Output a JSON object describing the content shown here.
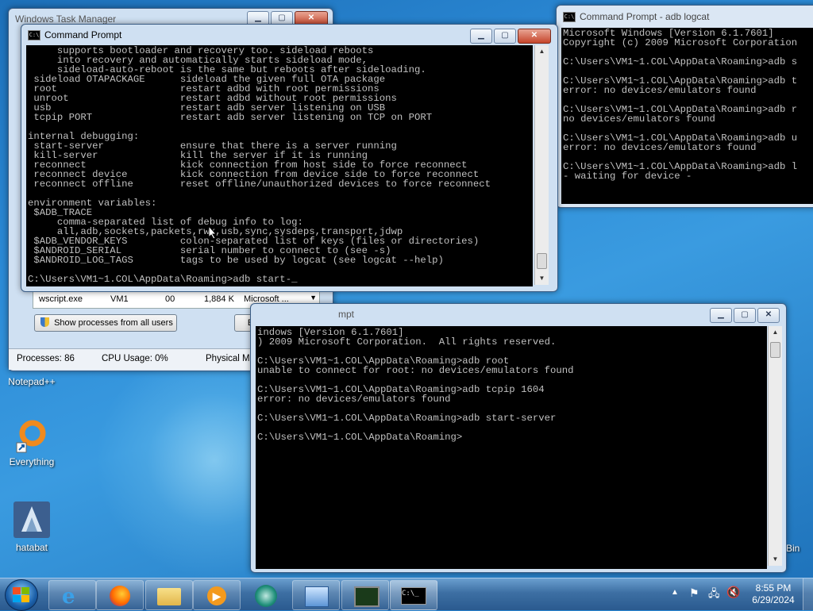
{
  "desktop": {
    "icons": [
      {
        "label": "Notepad++"
      },
      {
        "label": "Everything"
      },
      {
        "label": "hatabat"
      }
    ],
    "recycle_partial": "Bin"
  },
  "task_manager": {
    "title_partial": "Windows Task Manager",
    "row": {
      "name": "wscript.exe",
      "user": "VM1",
      "cpu": "00",
      "memory": "1,884 K",
      "description": "Microsoft ..."
    },
    "show_all_label": "Show processes from all users",
    "end_process_label": "End Process",
    "status": {
      "processes": "Processes: 86",
      "cpu": "CPU Usage: 0%",
      "memory": "Physical Memory: 41%"
    }
  },
  "cmd_main": {
    "title": "Command Prompt",
    "lines": [
      "     supports bootloader and recovery too. sideload reboots",
      "     into recovery and automatically starts sideload mode,",
      "     sideload-auto-reboot is the same but reboots after sideloading.",
      " sideload OTAPACKAGE      sideload the given full OTA package",
      " root                     restart adbd with root permissions",
      " unroot                   restart adbd without root permissions",
      " usb                      restart adb server listening on USB",
      " tcpip PORT               restart adb server listening on TCP on PORT",
      "",
      "internal debugging:",
      " start-server             ensure that there is a server running",
      " kill-server              kill the server if it is running",
      " reconnect                kick connection from host side to force reconnect",
      " reconnect device         kick connection from device side to force reconnect",
      " reconnect offline        reset offline/unauthorized devices to force reconnect",
      "",
      "environment variables:",
      " $ADB_TRACE",
      "     comma-separated list of debug info to log:",
      "     all,adb,sockets,packets,rwx,usb,sync,sysdeps,transport,jdwp",
      " $ADB_VENDOR_KEYS         colon-separated list of keys (files or directories)",
      " $ANDROID_SERIAL          serial number to connect to (see -s)",
      " $ANDROID_LOG_TAGS        tags to be used by logcat (see logcat --help)",
      "",
      "C:\\Users\\VM1~1.COL\\AppData\\Roaming>adb start-"
    ]
  },
  "cmd_logcat": {
    "title": "Command Prompt - adb  logcat",
    "lines": [
      "Microsoft Windows [Version 6.1.7601]",
      "Copyright (c) 2009 Microsoft Corporation",
      "",
      "C:\\Users\\VM1~1.COL\\AppData\\Roaming>adb s",
      "",
      "C:\\Users\\VM1~1.COL\\AppData\\Roaming>adb t",
      "error: no devices/emulators found",
      "",
      "C:\\Users\\VM1~1.COL\\AppData\\Roaming>adb r",
      "no devices/emulators found",
      "",
      "C:\\Users\\VM1~1.COL\\AppData\\Roaming>adb u",
      "error: no devices/emulators found",
      "",
      "C:\\Users\\VM1~1.COL\\AppData\\Roaming>adb l",
      "- waiting for device -"
    ]
  },
  "cmd_third": {
    "title": "mpt",
    "lines": [
      "indows [Version 6.1.7601]",
      ") 2009 Microsoft Corporation.  All rights reserved.",
      "",
      "C:\\Users\\VM1~1.COL\\AppData\\Roaming>adb root",
      "unable to connect for root: no devices/emulators found",
      "",
      "C:\\Users\\VM1~1.COL\\AppData\\Roaming>adb tcpip 1604",
      "error: no devices/emulators found",
      "",
      "C:\\Users\\VM1~1.COL\\AppData\\Roaming>adb start-server",
      "",
      "C:\\Users\\VM1~1.COL\\AppData\\Roaming>"
    ]
  },
  "taskbar": {
    "time": "8:55 PM",
    "date": "6/29/2024"
  }
}
